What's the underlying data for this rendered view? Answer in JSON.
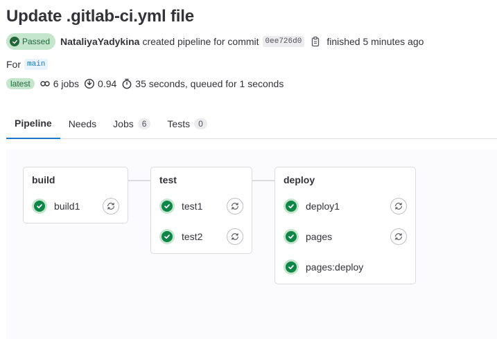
{
  "header": {
    "title": "Update .gitlab-ci.yml file",
    "status": "Passed",
    "author": "NataliyaYadykina",
    "created_text": "created pipeline for commit",
    "commit_sha": "0ee726d0",
    "finished_text": "finished 5 minutes ago",
    "for_label": "For",
    "ref": "main",
    "latest_badge": "latest",
    "jobs_count_text": "6 jobs",
    "coverage_text": "0.94",
    "duration_text": "35 seconds, queued for 1 seconds"
  },
  "tabs": [
    {
      "label": "Pipeline",
      "active": true
    },
    {
      "label": "Needs"
    },
    {
      "label": "Jobs",
      "count": "6"
    },
    {
      "label": "Tests",
      "count": "0"
    }
  ],
  "stages": [
    {
      "name": "build",
      "jobs": [
        {
          "name": "build1",
          "retry": true
        }
      ]
    },
    {
      "name": "test",
      "jobs": [
        {
          "name": "test1",
          "retry": true
        },
        {
          "name": "test2",
          "retry": true
        }
      ]
    },
    {
      "name": "deploy",
      "jobs": [
        {
          "name": "deploy1",
          "retry": true
        },
        {
          "name": "pages",
          "retry": true
        },
        {
          "name": "pages:deploy",
          "retry": false
        }
      ]
    }
  ],
  "colors": {
    "success": "#108548",
    "success_bg": "#c3e6cd",
    "link": "#1f75cb"
  },
  "icons": {
    "status": "status-success-icon",
    "copy": "copy-to-clipboard-icon",
    "jobs": "pipeline-jobs-icon",
    "coverage": "coverage-icon",
    "timer": "timer-icon",
    "retry": "retry-icon"
  }
}
